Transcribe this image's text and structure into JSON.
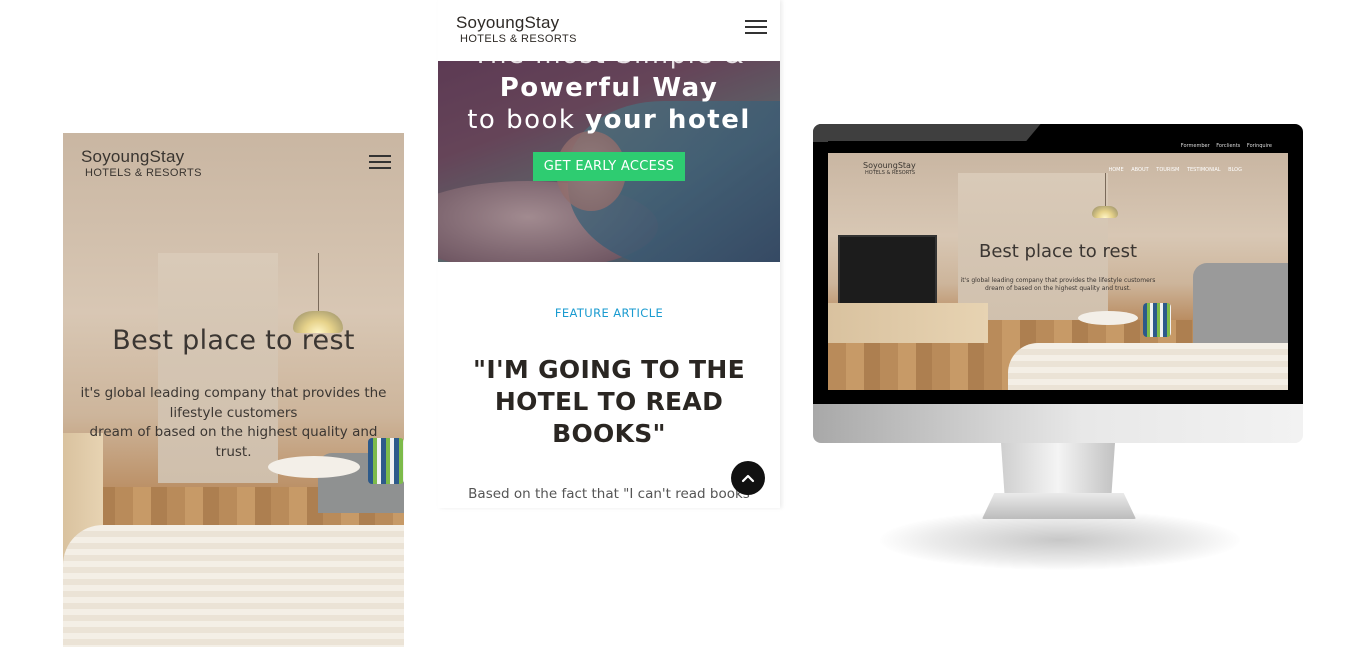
{
  "brand": {
    "name": "SoyoungStay",
    "sub": "HOTELS & RESORTS"
  },
  "hero": {
    "title": "Best place to rest",
    "line1": "it's global leading company that provides the",
    "line2": "lifestyle customers",
    "line3": "dream of based on the highest quality and",
    "line4": "trust."
  },
  "promo": {
    "line1": "The most Simple &",
    "line2": "Powerful Way",
    "line3_prefix": "to book",
    "line3_bold": "your hotel",
    "cta_label": "GET EARLY ACCESS"
  },
  "article": {
    "label": "FEATURE ARTICLE",
    "title_line1": "\"I'M GOING TO THE",
    "title_line2": "HOTEL TO READ",
    "title_line3": "BOOKS\"",
    "body": "Based on the fact that \"I can't read books"
  },
  "desktop": {
    "top_links": [
      "Formember",
      "Forclients",
      "Forinquire"
    ],
    "nav": [
      "HOME",
      "ABOUT",
      "TOURISM",
      "TESTIMONIAL",
      "BLOG"
    ],
    "text_line1": "it's global leading company that provides the lifestyle customers",
    "text_line2": "dream of based on the highest quality and trust."
  },
  "icons": {
    "menu": "hamburger-menu-icon",
    "back_to_top": "chevron-up-icon"
  },
  "colors": {
    "accent_green": "#2ecc71",
    "label_blue": "#1a9bd0"
  }
}
